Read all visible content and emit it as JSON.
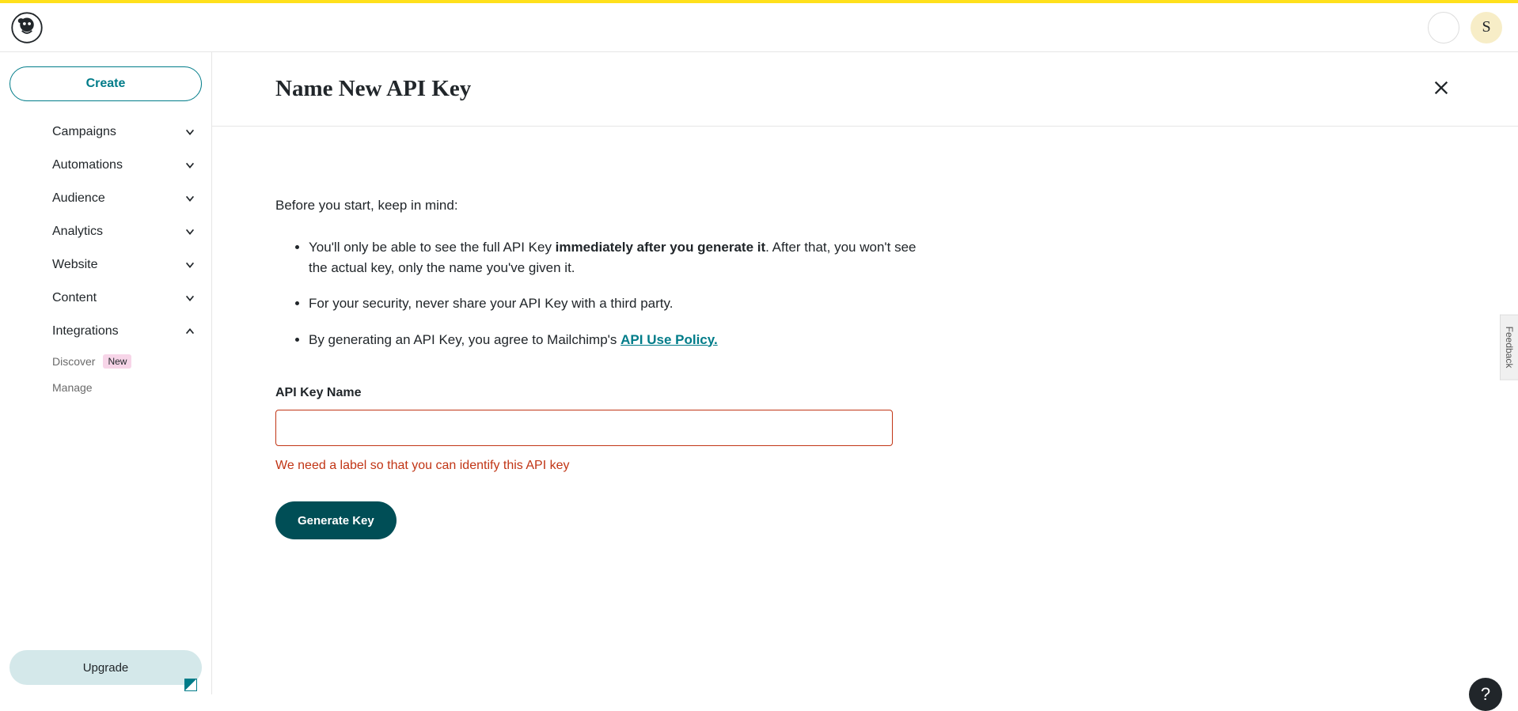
{
  "topbar": {
    "avatar_initial": "S"
  },
  "sidebar": {
    "create_label": "Create",
    "items": [
      {
        "label": "Campaigns",
        "expanded": false
      },
      {
        "label": "Automations",
        "expanded": false
      },
      {
        "label": "Audience",
        "expanded": false
      },
      {
        "label": "Analytics",
        "expanded": false
      },
      {
        "label": "Website",
        "expanded": false
      },
      {
        "label": "Content",
        "expanded": false
      },
      {
        "label": "Integrations",
        "expanded": true
      }
    ],
    "integrations_sub": [
      {
        "label": "Discover",
        "badge": "New"
      },
      {
        "label": "Manage",
        "badge": null
      }
    ],
    "upgrade_label": "Upgrade"
  },
  "main": {
    "title": "Name New API Key",
    "intro": "Before you start, keep in mind:",
    "bullets": {
      "b1_pre": "You'll only be able to see the full API Key ",
      "b1_strong": "immediately after you generate it",
      "b1_post": ". After that, you won't see the actual key, only the name you've given it.",
      "b2": "For your security, never share your API Key with a third party.",
      "b3_pre": "By generating an API Key, you agree to Mailchimp's ",
      "b3_link": "API Use Policy."
    },
    "field_label": "API Key Name",
    "input_value": "",
    "error": "We need a label so that you can identify this API key",
    "generate_label": "Generate Key"
  },
  "feedback_label": "Feedback",
  "help_label": "?"
}
